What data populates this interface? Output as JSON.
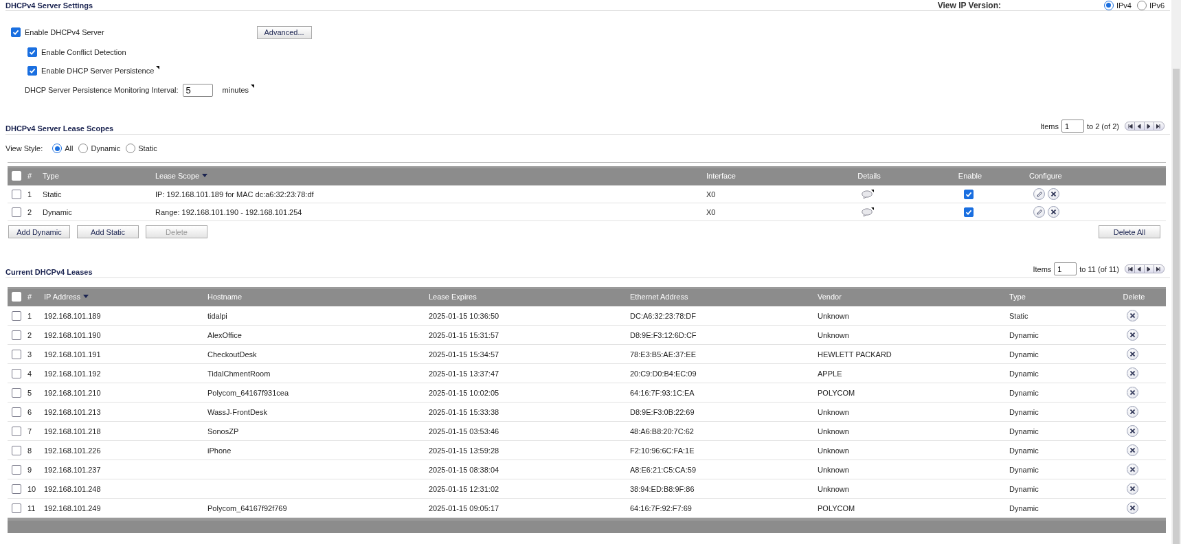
{
  "settings": {
    "title": "DHCPv4 Server Settings",
    "ip_version": {
      "label": "View IP Version:",
      "options": [
        {
          "label": "IPv4",
          "selected": true
        },
        {
          "label": "IPv6",
          "selected": false
        }
      ]
    },
    "options": [
      {
        "label": "Enable DHCPv4 Server",
        "checked": true,
        "hint": false,
        "children": [
          {
            "label": "Enable Conflict Detection",
            "checked": true,
            "hint": false
          },
          {
            "label": "Enable DHCP Server Persistence",
            "checked": true,
            "hint": true
          }
        ]
      }
    ],
    "advanced_button": "Advanced...",
    "interval": {
      "label": "DHCP Server Persistence Monitoring Interval:",
      "value": "5",
      "unit": "minutes",
      "hint": true
    }
  },
  "lease_scopes": {
    "title": "DHCPv4 Server Lease Scopes",
    "pagination": {
      "label": "Items",
      "value": "1",
      "range": "to 2 (of 2)"
    },
    "view_style": {
      "label": "View Style:",
      "options": [
        {
          "label": "All",
          "selected": true
        },
        {
          "label": "Dynamic",
          "selected": false
        },
        {
          "label": "Static",
          "selected": false
        }
      ]
    },
    "select_all_checked": false,
    "columns": [
      {
        "label": "#",
        "sorted": false
      },
      {
        "label": "Type",
        "sorted": false
      },
      {
        "label": "Lease Scope",
        "sorted": true
      },
      {
        "label": "Interface",
        "sorted": false
      },
      {
        "label": "Details",
        "sorted": false
      },
      {
        "label": "Enable",
        "sorted": false
      },
      {
        "label": "Configure",
        "sorted": false
      }
    ],
    "rows": [
      {
        "checked": false,
        "number": "1",
        "type": "Static",
        "lease_scope": "IP: 192.168.101.189 for MAC dc:a6:32:23:78:df",
        "interface": "X0",
        "enabled": true
      },
      {
        "checked": false,
        "number": "2",
        "type": "Dynamic",
        "lease_scope": "Range: 192.168.101.190 - 192.168.101.254",
        "interface": "X0",
        "enabled": true
      }
    ],
    "buttons": [
      {
        "label": "Add Dynamic",
        "disabled": false
      },
      {
        "label": "Add Static",
        "disabled": false
      },
      {
        "label": "Delete",
        "disabled": true
      }
    ],
    "delete_all_button": "Delete All"
  },
  "current_leases": {
    "title": "Current DHCPv4 Leases",
    "pagination": {
      "label": "Items",
      "value": "1",
      "range": "to 11 (of 11)"
    },
    "select_all_checked": false,
    "columns": [
      {
        "label": "#",
        "sorted": false
      },
      {
        "label": "IP Address",
        "sorted": true
      },
      {
        "label": "Hostname",
        "sorted": false
      },
      {
        "label": "Lease Expires",
        "sorted": false
      },
      {
        "label": "Ethernet Address",
        "sorted": false
      },
      {
        "label": "Vendor",
        "sorted": false
      },
      {
        "label": "Type",
        "sorted": false
      },
      {
        "label": "Delete",
        "sorted": false
      }
    ],
    "rows": [
      {
        "checked": false,
        "number": "1",
        "ip": "192.168.101.189",
        "hostname": "tidalpi",
        "expires": "2025-01-15 10:36:50",
        "mac": "DC:A6:32:23:78:DF",
        "vendor": "Unknown",
        "type": "Static"
      },
      {
        "checked": false,
        "number": "2",
        "ip": "192.168.101.190",
        "hostname": "AlexOffice",
        "expires": "2025-01-15 15:31:57",
        "mac": "D8:9E:F3:12:6D:CF",
        "vendor": "Unknown",
        "type": "Dynamic"
      },
      {
        "checked": false,
        "number": "3",
        "ip": "192.168.101.191",
        "hostname": "CheckoutDesk",
        "expires": "2025-01-15 15:34:57",
        "mac": "78:E3:B5:AE:37:EE",
        "vendor": "HEWLETT PACKARD",
        "type": "Dynamic"
      },
      {
        "checked": false,
        "number": "4",
        "ip": "192.168.101.192",
        "hostname": "TidalChmentRoom",
        "expires": "2025-01-15 13:37:47",
        "mac": "20:C9:D0:B4:EC:09",
        "vendor": "APPLE",
        "type": "Dynamic"
      },
      {
        "checked": false,
        "number": "5",
        "ip": "192.168.101.210",
        "hostname": "Polycom_64167f931cea",
        "expires": "2025-01-15 10:02:05",
        "mac": "64:16:7F:93:1C:EA",
        "vendor": "POLYCOM",
        "type": "Dynamic"
      },
      {
        "checked": false,
        "number": "6",
        "ip": "192.168.101.213",
        "hostname": "WassJ-FrontDesk",
        "expires": "2025-01-15 15:33:38",
        "mac": "D8:9E:F3:0B:22:69",
        "vendor": "Unknown",
        "type": "Dynamic"
      },
      {
        "checked": false,
        "number": "7",
        "ip": "192.168.101.218",
        "hostname": "SonosZP",
        "expires": "2025-01-15 03:53:46",
        "mac": "48:A6:B8:20:7C:62",
        "vendor": "Unknown",
        "type": "Dynamic"
      },
      {
        "checked": false,
        "number": "8",
        "ip": "192.168.101.226",
        "hostname": "iPhone",
        "expires": "2025-01-15 13:59:28",
        "mac": "F2:10:96:6C:FA:1E",
        "vendor": "Unknown",
        "type": "Dynamic"
      },
      {
        "checked": false,
        "number": "9",
        "ip": "192.168.101.237",
        "expires": "2025-01-15 08:38:04",
        "mac": "A8:E6:21:C5:CA:59",
        "vendor": "Unknown",
        "type": "Dynamic"
      },
      {
        "checked": false,
        "number": "10",
        "ip": "192.168.101.248",
        "expires": "2025-01-15 12:31:02",
        "mac": "38:94:ED:B8:9F:86",
        "vendor": "Unknown",
        "type": "Dynamic"
      },
      {
        "checked": false,
        "number": "11",
        "ip": "192.168.101.249",
        "hostname": "Polycom_64167f92f769",
        "expires": "2025-01-15 09:05:17",
        "mac": "64:16:7F:92:F7:69",
        "vendor": "POLYCOM",
        "type": "Dynamic"
      }
    ]
  }
}
